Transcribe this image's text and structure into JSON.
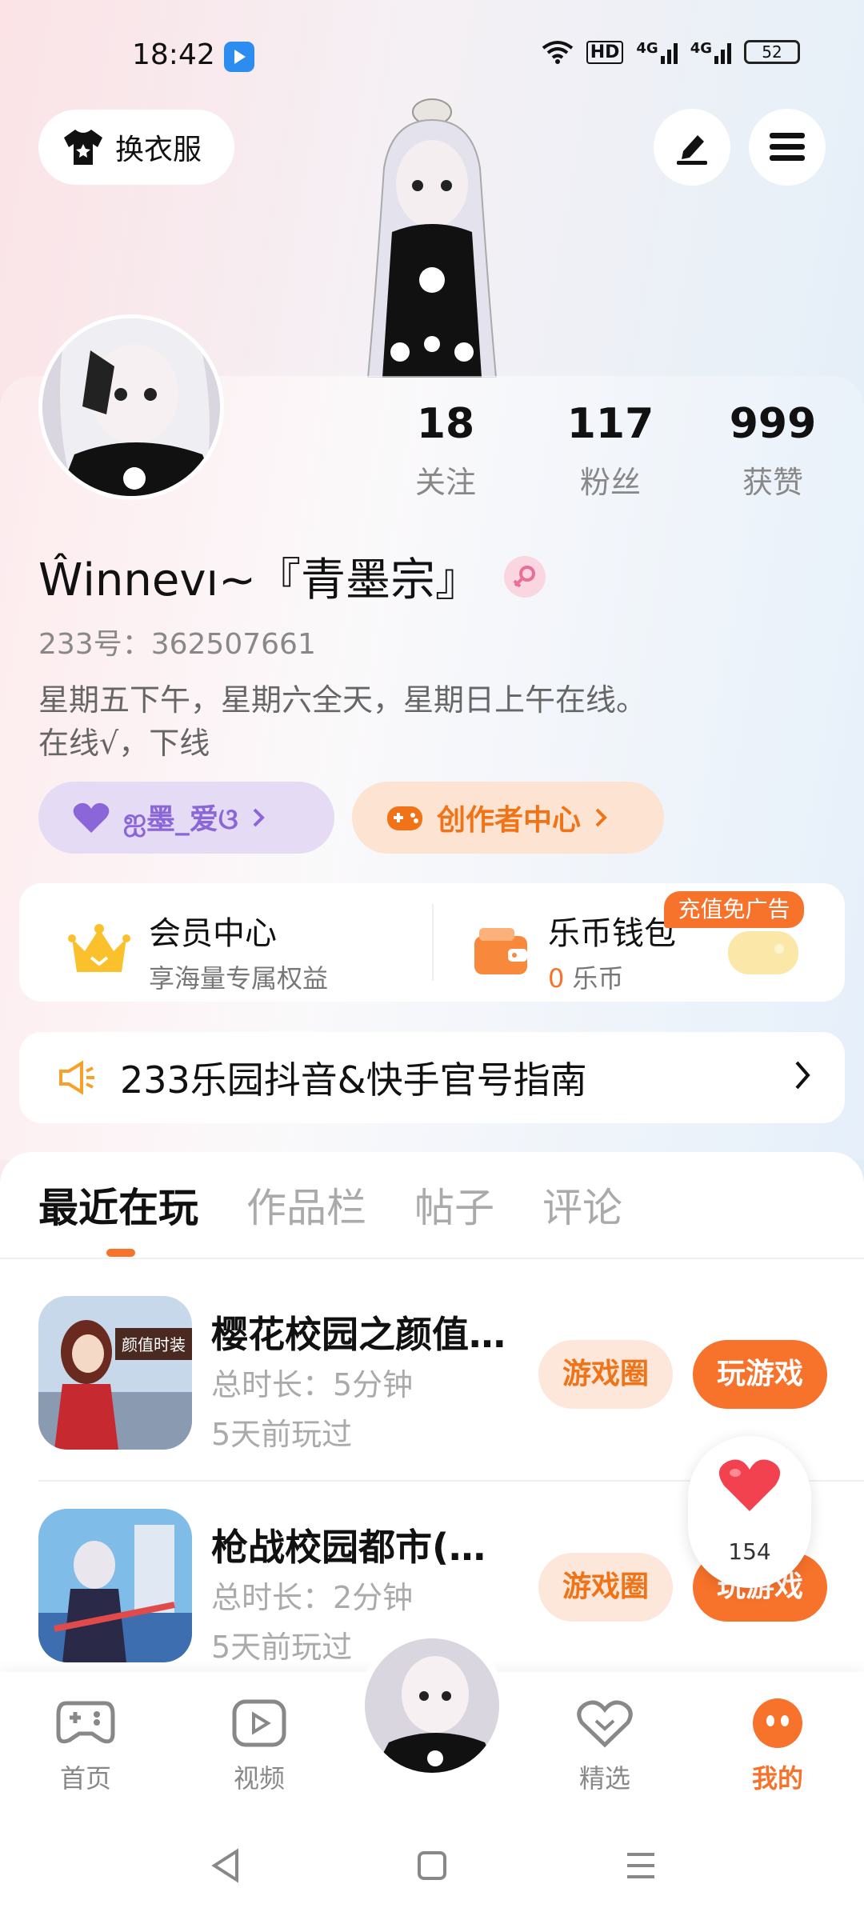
{
  "status_bar": {
    "time": "18:42",
    "hd": "HD",
    "net1": "4G",
    "net2": "4G",
    "battery": "52"
  },
  "top": {
    "outfit_label": "换衣服"
  },
  "stats": [
    {
      "num": "18",
      "label": "关注"
    },
    {
      "num": "117",
      "label": "粉丝"
    },
    {
      "num": "999",
      "label": "获赞"
    }
  ],
  "profile": {
    "name": "Ŵinnevı~『青墨宗』",
    "uid": "233号：362507661",
    "bio_line1": "星期五下午，星期六全天，星期日上午在线。",
    "bio_line2": "在线√，下线"
  },
  "pills": {
    "cp": "ஐ墨_爱ଓ",
    "creator": "创作者中心"
  },
  "vip": {
    "member_title": "会员中心",
    "member_sub": "享海量专属权益",
    "wallet_title": "乐币钱包",
    "wallet_amount": "0",
    "wallet_unit": "乐币",
    "ad_badge": "充值免广告"
  },
  "guide": {
    "label": "233乐园抖音&快手官号指南"
  },
  "tabs": [
    "最近在玩",
    "作品栏",
    "帖子",
    "评论"
  ],
  "games": [
    {
      "title": "樱花校园之颜值…",
      "duration": "总时长：5分钟",
      "ago": "5天前玩过",
      "circle": "游戏圈",
      "play": "玩游戏",
      "icon_text": "颜值时装"
    },
    {
      "title": "枪战校园都市(…",
      "duration": "总时长：2分钟",
      "ago": "5天前玩过",
      "circle": "游戏圈",
      "play": "玩游戏"
    }
  ],
  "like": {
    "count": "154"
  },
  "nav": [
    {
      "label": "首页"
    },
    {
      "label": "视频"
    },
    {
      "label": "精选"
    },
    {
      "label": "我的"
    }
  ],
  "colors": {
    "accent": "#f7722a",
    "purple": "#8a66d8"
  }
}
